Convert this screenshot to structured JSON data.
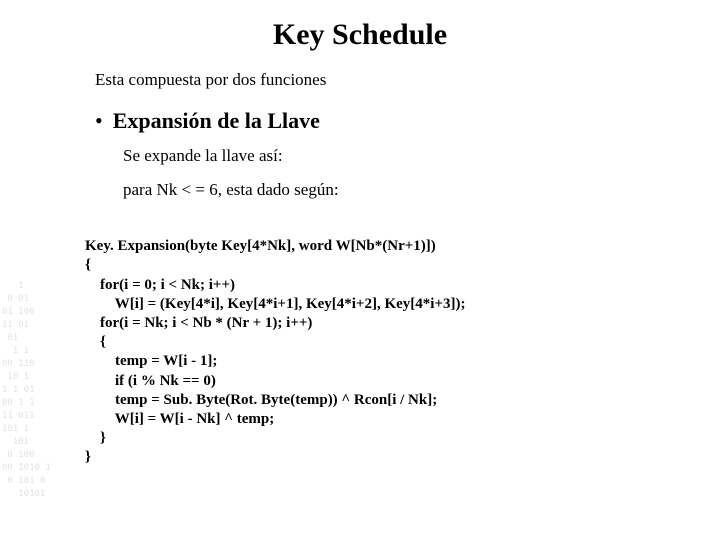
{
  "title": "Key Schedule",
  "intro": "Esta compuesta por dos funciones",
  "bullet": "Expansión de la Llave",
  "sub1": "Se expande la llave así:",
  "sub2": "para Nk < = 6, esta dado según:",
  "code_l1": "Key. Expansion(byte Key[4*Nk], word W[Nb*(Nr+1)])",
  "code_l2": "{",
  "code_l3": "    for(i = 0; i < Nk; i++)",
  "code_l4": "        W[i] = (Key[4*i], Key[4*i+1], Key[4*i+2], Key[4*i+3]);",
  "code_l5": "    for(i = Nk; i < Nb * (Nr + 1); i++)",
  "code_l6": "    {",
  "code_l7": "        temp = W[i - 1];",
  "code_l8": "        if (i % Nk == 0)",
  "code_l9": "        temp = Sub. Byte(Rot. Byte(temp)) ^ Rcon[i / Nk];",
  "code_l10": "        W[i] = W[i - Nk] ^ temp;",
  "code_l11": "    }",
  "code_l12": "}",
  "deco": "   1\n 0 01\n01 100\n11 01\n 01\n  1 1\n00 110\n 10 1\n1 1 01\n00 1 1\n11 011\n101 1\n  101\n 0 100\n00 1010 1\n 0 101 0\n   10101"
}
